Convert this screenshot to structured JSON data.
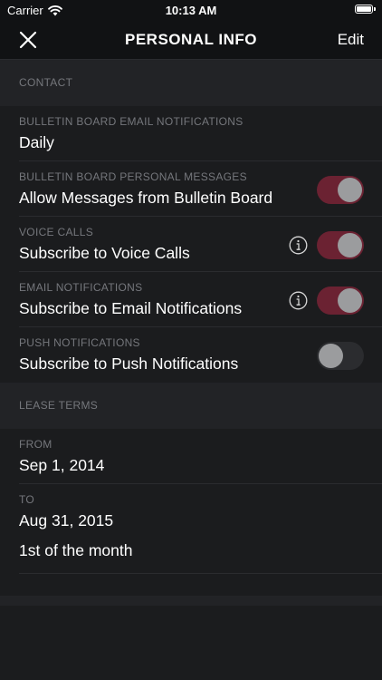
{
  "status_bar": {
    "carrier": "Carrier",
    "time": "10:13 AM"
  },
  "nav": {
    "title": "PERSONAL INFO",
    "edit_label": "Edit",
    "close_icon": "close-icon"
  },
  "sections": {
    "contact": {
      "header": "CONTACT",
      "rows": [
        {
          "label": "BULLETIN BOARD EMAIL NOTIFICATIONS",
          "value": "Daily"
        },
        {
          "label": "BULLETIN BOARD PERSONAL MESSAGES",
          "value": "Allow Messages from Bulletin Board",
          "toggle": "on"
        },
        {
          "label": "VOICE CALLS",
          "value": "Subscribe to Voice Calls",
          "toggle": "on",
          "info_icon": true
        },
        {
          "label": "EMAIL NOTIFICATIONS",
          "value": "Subscribe to Email Notifications",
          "toggle": "on",
          "info_icon": true
        },
        {
          "label": "PUSH NOTIFICATIONS",
          "value": "Subscribe to Push Notifications",
          "toggle": "off"
        }
      ]
    },
    "lease_terms": {
      "header": "LEASE TERMS",
      "rows": [
        {
          "label": "FROM",
          "value": "Sep 1, 2014"
        },
        {
          "label": "TO",
          "value": "Aug 31, 2015"
        },
        {
          "value": "1st of the month"
        }
      ]
    }
  },
  "colors": {
    "background": "#1b1c1e",
    "section_header_bg": "#222326",
    "toggle_on": "#6b2232",
    "toggle_off": "#2b2c2f",
    "label_gray": "#75777c"
  }
}
